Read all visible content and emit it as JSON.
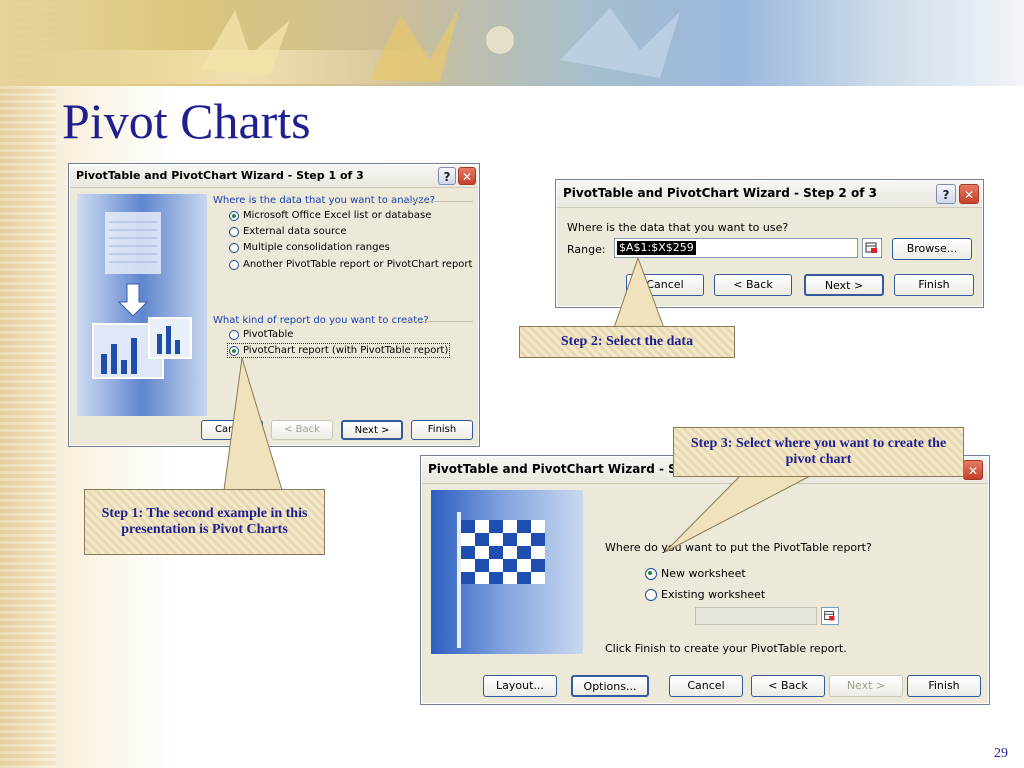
{
  "slide": {
    "title": "Pivot Charts",
    "page_number": "29"
  },
  "dialog1": {
    "title": "PivotTable and PivotChart Wizard - Step 1 of 3",
    "question1": "Where is the data that you want to analyze?",
    "sources": [
      {
        "label": "Microsoft Office Excel list or database",
        "selected": true
      },
      {
        "label": "External data source",
        "selected": false
      },
      {
        "label": "Multiple consolidation ranges",
        "selected": false
      },
      {
        "label": "Another PivotTable report or PivotChart report",
        "selected": false
      }
    ],
    "question2": "What kind of report do you want to create?",
    "report_types": [
      {
        "label": "PivotTable",
        "selected": false
      },
      {
        "label": "PivotChart report (with PivotTable report)",
        "selected": true
      }
    ],
    "buttons": {
      "cancel": "Cancel",
      "back": "< Back",
      "next": "Next >",
      "finish": "Finish"
    }
  },
  "dialog2": {
    "title": "PivotTable and PivotChart Wizard - Step 2 of 3",
    "question": "Where is the data that you want to use?",
    "range_label": "Range:",
    "range_value": "$A$1:$X$259",
    "buttons": {
      "browse": "Browse...",
      "cancel": "Cancel",
      "back": "< Back",
      "next": "Next >",
      "finish": "Finish"
    }
  },
  "dialog3": {
    "title": "PivotTable and PivotChart Wizard - Step 3 of 3",
    "question": "Where do you want to put the PivotTable report?",
    "locations": [
      {
        "label": "New worksheet",
        "selected": true
      },
      {
        "label": "Existing worksheet",
        "selected": false
      }
    ],
    "existing_value": "",
    "hint": "Click Finish to create your PivotTable report.",
    "buttons": {
      "layout": "Layout...",
      "options": "Options...",
      "cancel": "Cancel",
      "back": "< Back",
      "next": "Next >",
      "finish": "Finish"
    }
  },
  "callouts": {
    "step1": "Step 1: The second example in this presentation is Pivot Charts",
    "step2": "Step 2: Select the data",
    "step3": "Step 3: Select where you want to create the pivot chart"
  },
  "icons": [
    "help-icon",
    "close-icon",
    "range-collapse-icon",
    "wizard-chart-illustration",
    "checkered-flag-illustration"
  ],
  "colors": {
    "title_blue": "#1f1f8f",
    "dialog_face": "#ece9d8",
    "link_blue": "#1a40b8",
    "close_red": "#c6412a"
  }
}
